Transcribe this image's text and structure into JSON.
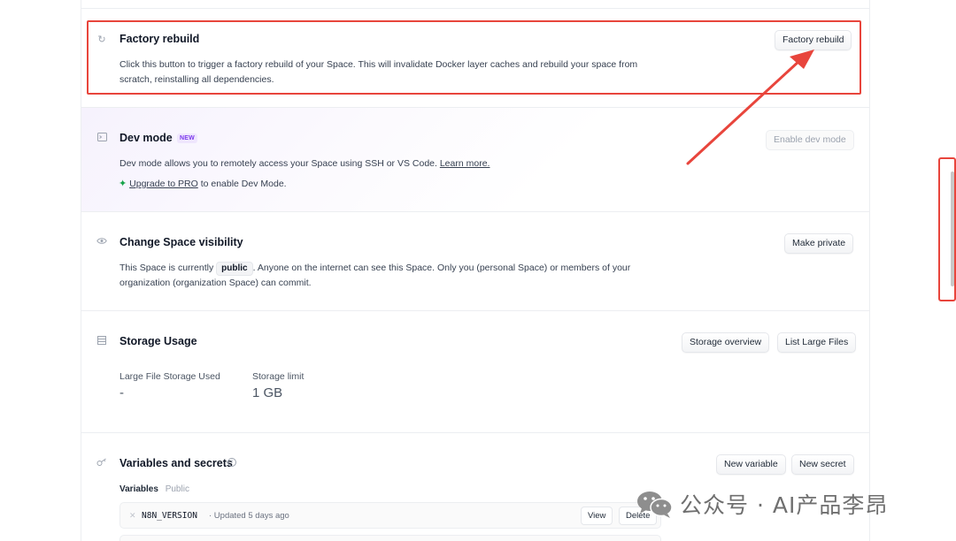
{
  "factory_rebuild": {
    "title": "Factory rebuild",
    "description": "Click this button to trigger a factory rebuild of your Space. This will invalidate Docker layer caches and rebuild your space from scratch, reinstalling all dependencies.",
    "button_label": "Factory rebuild"
  },
  "dev_mode": {
    "title": "Dev mode",
    "badge": "NEW",
    "description": "Dev mode allows you to remotely access your Space using SSH or VS Code.",
    "learn_more": "Learn more.",
    "upgrade_link": "Upgrade to PRO",
    "upgrade_suffix": "to enable Dev Mode.",
    "button_label": "Enable dev mode"
  },
  "visibility": {
    "title": "Change Space visibility",
    "desc_prefix": "This Space is currently",
    "status": "public",
    "desc_suffix": ". Anyone on the internet can see this Space. Only you (personal Space) or members of your organization (organization Space) can commit.",
    "button_label": "Make private"
  },
  "storage": {
    "title": "Storage Usage",
    "overview_button": "Storage overview",
    "list_button": "List Large Files",
    "lfs_label": "Large File Storage Used",
    "lfs_value": "-",
    "limit_label": "Storage limit",
    "limit_value": "1 GB"
  },
  "variables": {
    "title": "Variables and secrets",
    "new_variable_button": "New variable",
    "new_secret_button": "New secret",
    "subheading": "Variables",
    "subheading_scope": "Public",
    "rows": [
      {
        "name": "N8N_VERSION",
        "meta": "· Updated 5 days ago",
        "view": "View",
        "delete": "Delete"
      }
    ]
  },
  "watermark": {
    "text": "公众号 · AI产品李昂"
  },
  "colors": {
    "annotation": "#e8453c",
    "accent": "#7c3aed"
  }
}
